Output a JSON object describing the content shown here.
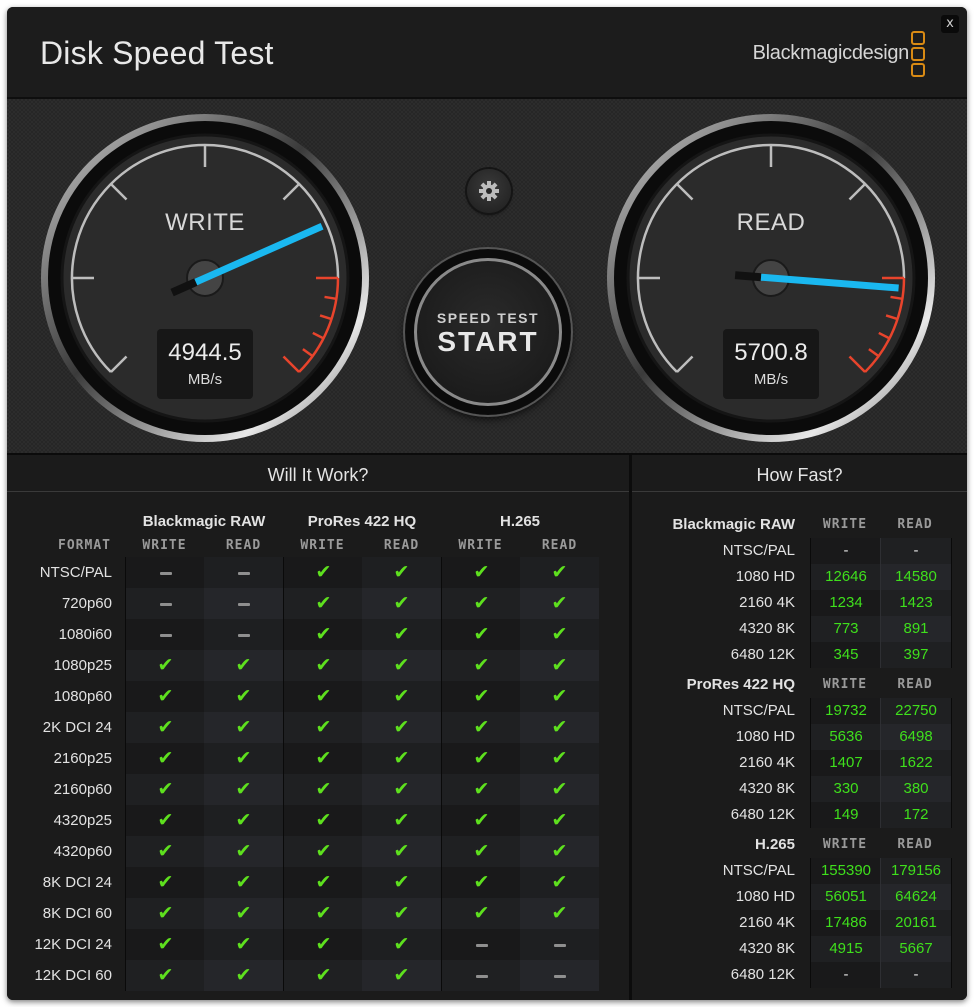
{
  "window": {
    "title": "Disk Speed Test",
    "brand": "Blackmagicdesign",
    "close_label": "x"
  },
  "colors": {
    "accent_brand": "#d88a14",
    "needle": "#1ab8f0",
    "redline": "#e8442c",
    "check": "#5ee01e",
    "value_green": "#3fe01c"
  },
  "gauges": {
    "write": {
      "label": "WRITE",
      "value": "4944.5",
      "unit": "MB/s",
      "needle_fraction": 0.745
    },
    "read": {
      "label": "READ",
      "value": "5700.8",
      "unit": "MB/s",
      "needle_fraction": 0.85
    }
  },
  "controls": {
    "settings_icon": "gear-icon",
    "start_small": "SPEED TEST",
    "start_big": "START"
  },
  "will_it_work": {
    "title": "Will It Work?",
    "format_header": "FORMAT",
    "codecs": [
      "Blackmagic RAW",
      "ProRes 422 HQ",
      "H.265"
    ],
    "sub_headers": [
      "WRITE",
      "READ"
    ],
    "rows": [
      {
        "format": "NTSC/PAL",
        "cells": [
          false,
          false,
          true,
          true,
          true,
          true
        ]
      },
      {
        "format": "720p60",
        "cells": [
          false,
          false,
          true,
          true,
          true,
          true
        ]
      },
      {
        "format": "1080i60",
        "cells": [
          false,
          false,
          true,
          true,
          true,
          true
        ]
      },
      {
        "format": "1080p25",
        "cells": [
          true,
          true,
          true,
          true,
          true,
          true
        ]
      },
      {
        "format": "1080p60",
        "cells": [
          true,
          true,
          true,
          true,
          true,
          true
        ]
      },
      {
        "format": "2K DCI 24",
        "cells": [
          true,
          true,
          true,
          true,
          true,
          true
        ]
      },
      {
        "format": "2160p25",
        "cells": [
          true,
          true,
          true,
          true,
          true,
          true
        ]
      },
      {
        "format": "2160p60",
        "cells": [
          true,
          true,
          true,
          true,
          true,
          true
        ]
      },
      {
        "format": "4320p25",
        "cells": [
          true,
          true,
          true,
          true,
          true,
          true
        ]
      },
      {
        "format": "4320p60",
        "cells": [
          true,
          true,
          true,
          true,
          true,
          true
        ]
      },
      {
        "format": "8K DCI 24",
        "cells": [
          true,
          true,
          true,
          true,
          true,
          true
        ]
      },
      {
        "format": "8K DCI 60",
        "cells": [
          true,
          true,
          true,
          true,
          true,
          true
        ]
      },
      {
        "format": "12K DCI 24",
        "cells": [
          true,
          true,
          true,
          true,
          false,
          false
        ]
      },
      {
        "format": "12K DCI 60",
        "cells": [
          true,
          true,
          true,
          true,
          false,
          false
        ]
      }
    ]
  },
  "how_fast": {
    "title": "How Fast?",
    "sub_headers": [
      "WRITE",
      "READ"
    ],
    "sections": [
      {
        "codec": "Blackmagic RAW",
        "rows": [
          {
            "res": "NTSC/PAL",
            "write": "-",
            "read": "-"
          },
          {
            "res": "1080 HD",
            "write": "12646",
            "read": "14580"
          },
          {
            "res": "2160 4K",
            "write": "1234",
            "read": "1423"
          },
          {
            "res": "4320 8K",
            "write": "773",
            "read": "891"
          },
          {
            "res": "6480 12K",
            "write": "345",
            "read": "397"
          }
        ]
      },
      {
        "codec": "ProRes 422 HQ",
        "rows": [
          {
            "res": "NTSC/PAL",
            "write": "19732",
            "read": "22750"
          },
          {
            "res": "1080 HD",
            "write": "5636",
            "read": "6498"
          },
          {
            "res": "2160 4K",
            "write": "1407",
            "read": "1622"
          },
          {
            "res": "4320 8K",
            "write": "330",
            "read": "380"
          },
          {
            "res": "6480 12K",
            "write": "149",
            "read": "172"
          }
        ]
      },
      {
        "codec": "H.265",
        "rows": [
          {
            "res": "NTSC/PAL",
            "write": "155390",
            "read": "179156"
          },
          {
            "res": "1080 HD",
            "write": "56051",
            "read": "64624"
          },
          {
            "res": "2160 4K",
            "write": "17486",
            "read": "20161"
          },
          {
            "res": "4320 8K",
            "write": "4915",
            "read": "5667"
          },
          {
            "res": "6480 12K",
            "write": "-",
            "read": "-"
          }
        ]
      }
    ]
  }
}
